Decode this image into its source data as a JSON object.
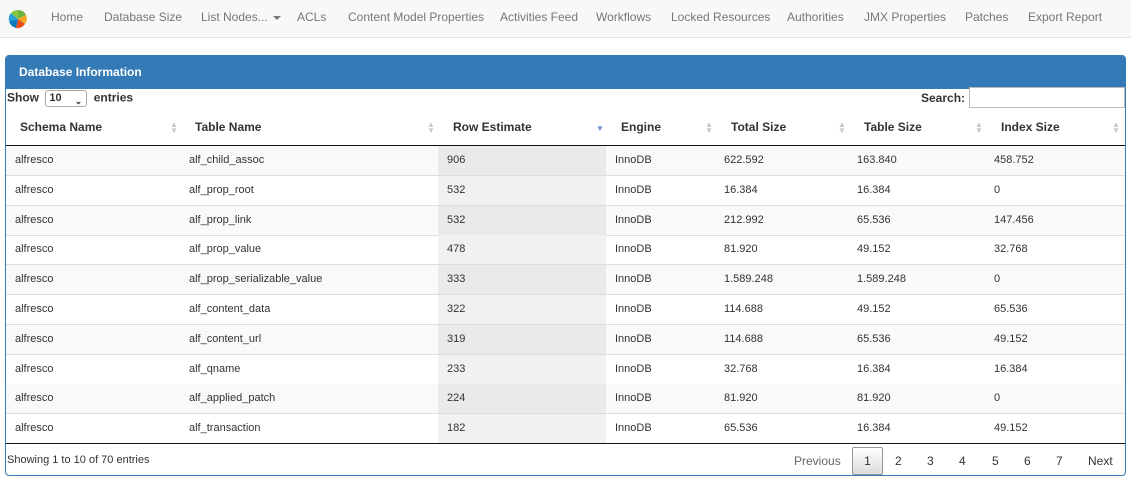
{
  "nav": {
    "items": [
      {
        "label": "Home"
      },
      {
        "label": "Database Size"
      },
      {
        "label": "List Nodes..."
      },
      {
        "label": "ACLs"
      },
      {
        "label": "Content Model Properties"
      },
      {
        "label": "Activities Feed"
      },
      {
        "label": "Workflows"
      },
      {
        "label": "Locked Resources"
      },
      {
        "label": "Authorities"
      },
      {
        "label": "JMX Properties"
      },
      {
        "label": "Patches"
      },
      {
        "label": "Export Report"
      }
    ]
  },
  "panel": {
    "title": "Database Information",
    "show_label": "Show",
    "entries_label": "entries",
    "page_length": "10",
    "search_label": "Search:",
    "search_value": ""
  },
  "table": {
    "columns": [
      "Schema Name",
      "Table Name",
      "Row Estimate",
      "Engine",
      "Total Size",
      "Table Size",
      "Index Size"
    ],
    "rows": [
      [
        "alfresco",
        "alf_child_assoc",
        "906",
        "InnoDB",
        "622.592",
        "163.840",
        "458.752"
      ],
      [
        "alfresco",
        "alf_prop_root",
        "532",
        "InnoDB",
        "16.384",
        "16.384",
        "0"
      ],
      [
        "alfresco",
        "alf_prop_link",
        "532",
        "InnoDB",
        "212.992",
        "65.536",
        "147.456"
      ],
      [
        "alfresco",
        "alf_prop_value",
        "478",
        "InnoDB",
        "81.920",
        "49.152",
        "32.768"
      ],
      [
        "alfresco",
        "alf_prop_serializable_value",
        "333",
        "InnoDB",
        "1.589.248",
        "1.589.248",
        "0"
      ],
      [
        "alfresco",
        "alf_content_data",
        "322",
        "InnoDB",
        "114.688",
        "49.152",
        "65.536"
      ],
      [
        "alfresco",
        "alf_content_url",
        "319",
        "InnoDB",
        "114.688",
        "65.536",
        "49.152"
      ],
      [
        "alfresco",
        "alf_qname",
        "233",
        "InnoDB",
        "32.768",
        "16.384",
        "16.384"
      ],
      [
        "alfresco",
        "alf_applied_patch",
        "224",
        "InnoDB",
        "81.920",
        "81.920",
        "0"
      ],
      [
        "alfresco",
        "alf_transaction",
        "182",
        "InnoDB",
        "65.536",
        "16.384",
        "49.152"
      ]
    ]
  },
  "footer": {
    "info": "Showing 1 to 10 of 70 entries",
    "previous": "Previous",
    "pages": [
      "1",
      "2",
      "3",
      "4",
      "5",
      "6",
      "7"
    ],
    "next": "Next"
  }
}
